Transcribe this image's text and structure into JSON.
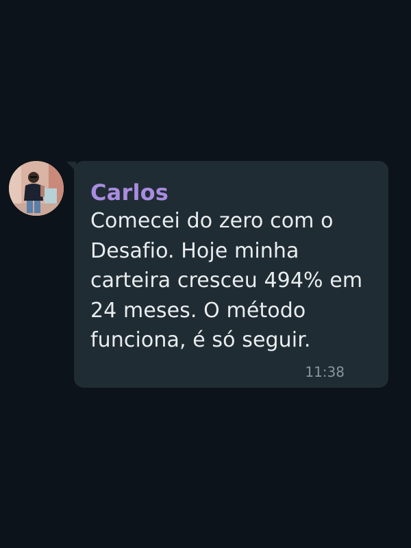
{
  "message": {
    "sender": "Carlos",
    "text": "Comecei do zero com o Desafio. Hoje minha carteira cresceu 494% em 24 meses. O método funciona, é só seguir.",
    "time": "11:38"
  },
  "colors": {
    "background": "#0c131a",
    "bubble": "#202c33",
    "sender": "#a98ce0",
    "text": "#e9edef",
    "timestamp": "#8696a0"
  }
}
